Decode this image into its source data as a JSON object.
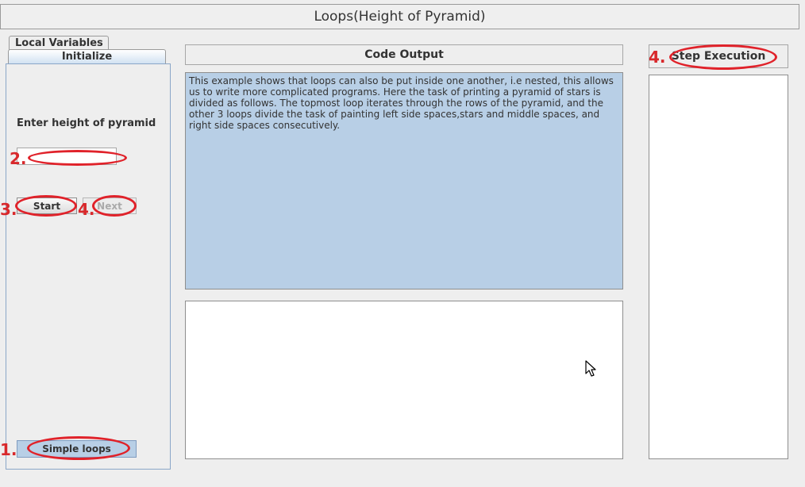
{
  "window": {
    "title": "Loops(Height of Pyramid)"
  },
  "tabs": [
    {
      "label": "Local Variables"
    },
    {
      "label": "Initialize"
    }
  ],
  "left_panel": {
    "height_label": "Enter height of pyramid",
    "height_input": {
      "value": "",
      "placeholder": ""
    },
    "start_label": "Start",
    "next_label": "Next",
    "simple_loops_label": "Simple loops"
  },
  "code_output": {
    "header": "Code Output",
    "description": "This example shows that loops can also be put inside one another, i.e nested, this allows us to write more complicated programs. Here the task of printing a pyramid of stars is divided as follows. The topmost loop iterates through the rows of the pyramid, and the other 3 loops divide the task of painting left side spaces,stars and middle spaces, and right side spaces consecutively.",
    "output": ""
  },
  "step_execution": {
    "header": "Step Execution"
  },
  "annotations": {
    "simple_loops": "1.",
    "input": "2.",
    "start": "3.",
    "next": "4.",
    "step": "4."
  },
  "colors": {
    "annotation": "#d8282b",
    "panel_blue": "#b8cfe6"
  }
}
